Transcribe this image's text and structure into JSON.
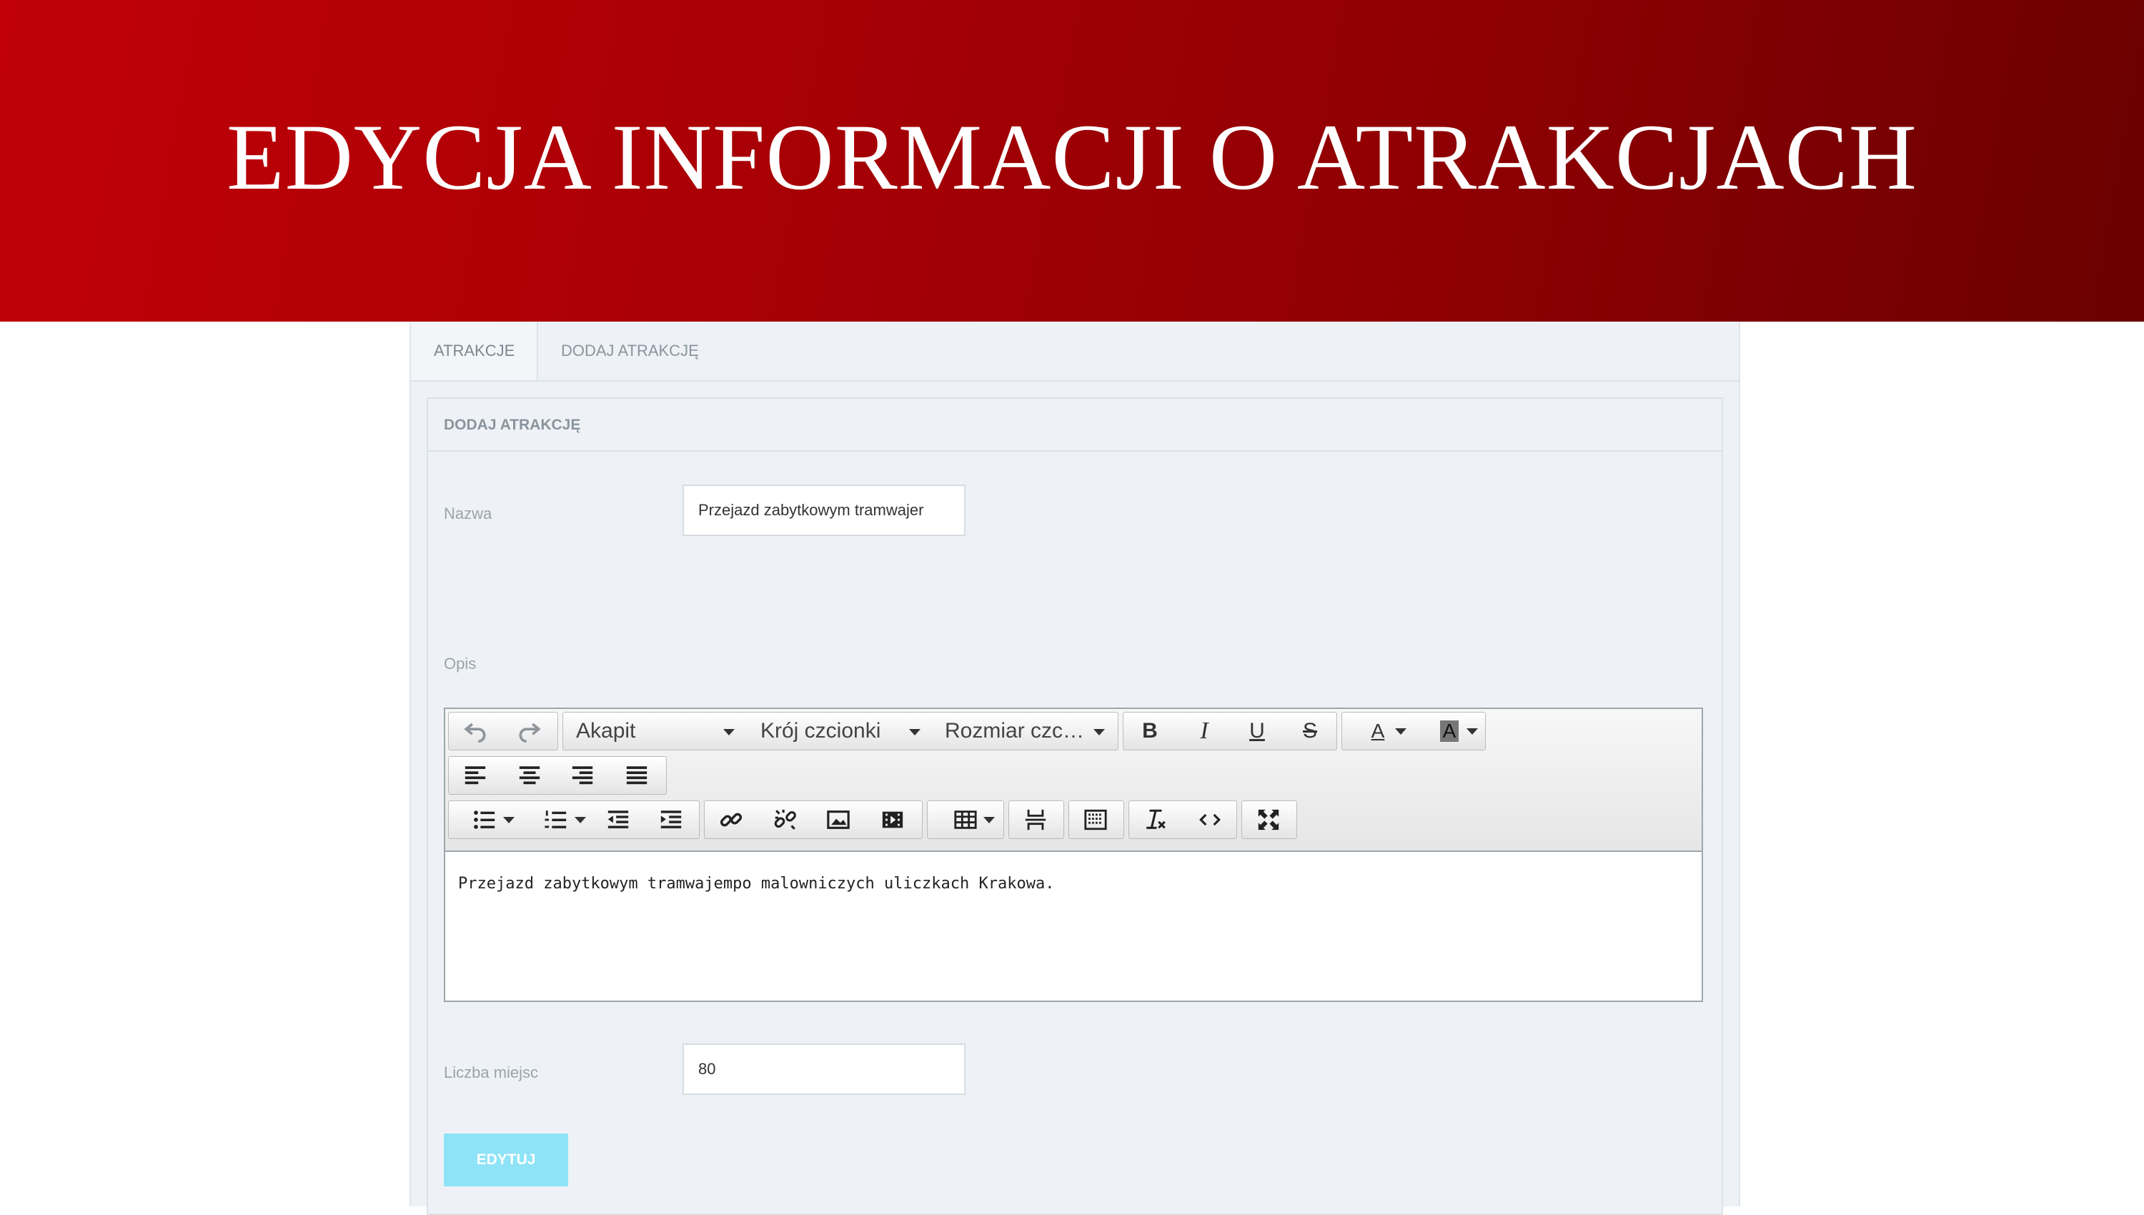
{
  "banner": {
    "title": "EDYCJA INFORMACJI O ATRAKCJACH"
  },
  "tabs": [
    {
      "label": "ATRAKCJE"
    },
    {
      "label": "DODAJ ATRAKCJĘ"
    }
  ],
  "form": {
    "heading": "DODAJ ATRAKCJĘ",
    "name_label": "Nazwa",
    "name_value": "Przejazd zabytkowym tramwajer",
    "desc_label": "Opis",
    "seats_label": "Liczba miejsc",
    "seats_value": "80",
    "submit_label": "EDYTUJ",
    "submit_color": "#8fe3f7"
  },
  "editor": {
    "format_select": "Akapit",
    "font_select": "Krój czcionki",
    "size_select": "Rozmiar czc…",
    "bold": "B",
    "italic": "I",
    "underline": "U",
    "strike": "S",
    "text_color": "A",
    "bg_color": "A",
    "content": "Przejazd zabytkowym tramwajempo malowniczych uliczkach Krakowa."
  },
  "icons": [
    "undo-icon",
    "redo-icon",
    "align-left-icon",
    "align-center-icon",
    "align-right-icon",
    "align-justify-icon",
    "bullet-list-icon",
    "numbered-list-icon",
    "outdent-icon",
    "indent-icon",
    "link-icon",
    "unlink-icon",
    "image-icon",
    "media-icon",
    "table-icon",
    "hr-icon",
    "special-char-icon",
    "clear-format-icon",
    "code-icon",
    "fullscreen-icon"
  ],
  "colors": {
    "banner_start": "#c10008",
    "banner_end": "#6a0000",
    "panel_bg": "#eef2f6"
  }
}
